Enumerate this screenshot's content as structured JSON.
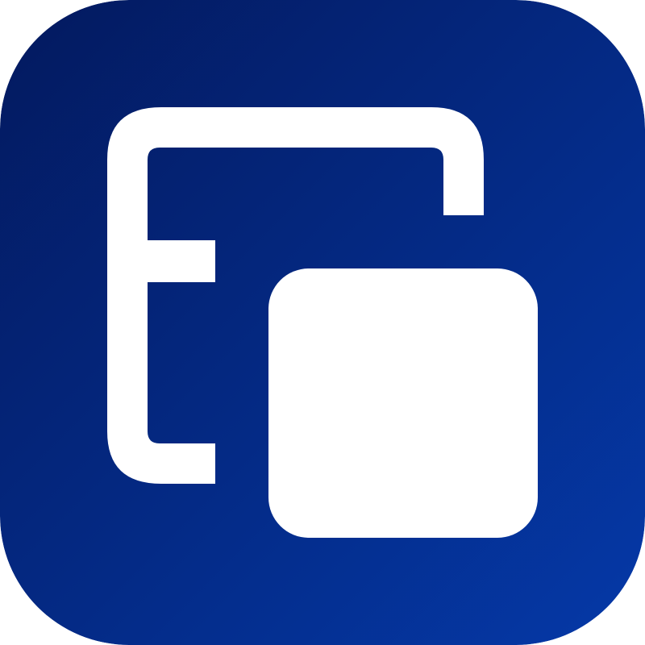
{
  "app_icon": {
    "icon": "window-overlap-icon",
    "colors": {
      "gradient_start": "#03195e",
      "gradient_end": "#0539a8",
      "glyph": "#ffffff"
    }
  }
}
